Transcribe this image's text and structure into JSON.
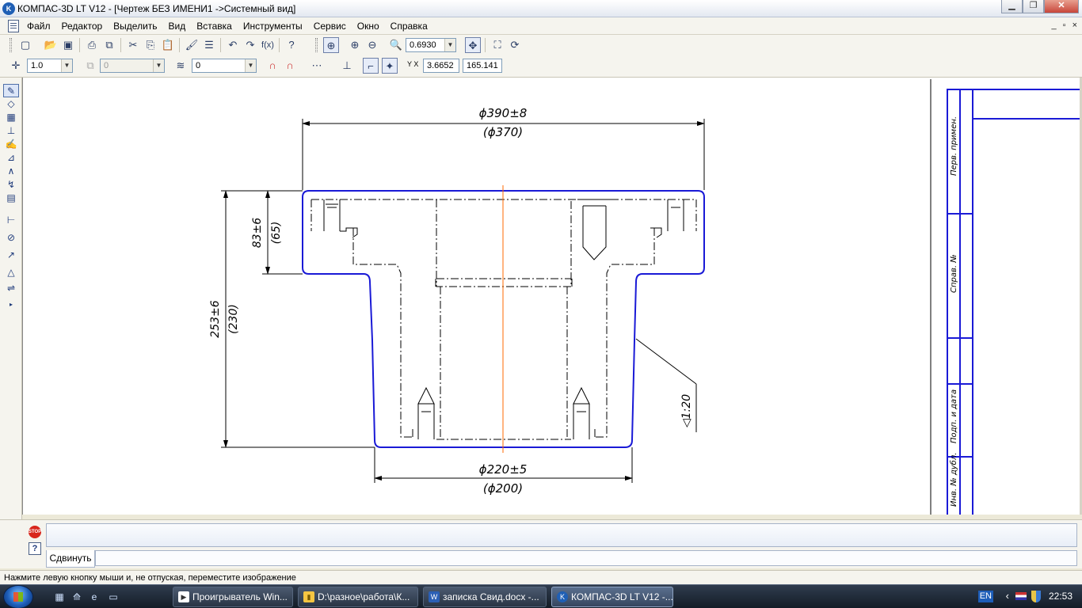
{
  "window": {
    "title": "КОМПАС-3D LT V12 - [Чертеж БЕЗ ИМЕНИ1 ->Системный вид]",
    "app_icon_text": "K",
    "minimize_glyph": "▁",
    "restore_glyph": "❐",
    "close_glyph": "✕"
  },
  "menu": {
    "items": [
      "Файл",
      "Редактор",
      "Выделить",
      "Вид",
      "Вставка",
      "Инструменты",
      "Сервис",
      "Окно",
      "Справка"
    ],
    "mdi": [
      "_",
      "▫",
      "×"
    ]
  },
  "toolbar1": {
    "zoom_value": "0.6930",
    "function_label": "f(x)"
  },
  "toolbar2": {
    "line_scale": "1.0",
    "layer_disabled": "0",
    "style_value": "0",
    "coord_x": "3.6652",
    "coord_y": "165.141",
    "coord_label": "Y X"
  },
  "left_tools": [
    "✎",
    "◇",
    "▦",
    "⊥",
    "✍",
    "⊿",
    "∧",
    "↯",
    "▤",
    "⊢",
    "⊘",
    "↗",
    "△",
    "⇌",
    "▸"
  ],
  "drawing": {
    "dim_top_outer": "ϕ390±8",
    "dim_top_inner": "(ϕ370)",
    "dim_flange_h": "83±6",
    "dim_flange_h_ref": "(65)",
    "dim_total_h": "253±6",
    "dim_total_h_ref": "(230)",
    "dim_bottom_outer": "ϕ220±5",
    "dim_bottom_inner": "(ϕ200)",
    "taper": "◁1:20",
    "frame_labels": [
      "Перв. примен.",
      "Справ. №",
      "Подп. и дата",
      "Инв. № дубл."
    ],
    "colors": {
      "outline": "#1a1ad6",
      "axis": "#ff6a00",
      "line": "#000000"
    }
  },
  "command": {
    "stop_label": "STOP",
    "help_label": "?",
    "tab_label": "Сдвинуть"
  },
  "status": {
    "text": "Нажмите левую кнопку мыши и, не отпуская, переместите изображение"
  },
  "taskbar": {
    "tasks": [
      {
        "label": "Проигрыватель Win...",
        "icon": "▶",
        "color": "#ffffff"
      },
      {
        "label": "D:\\разное\\работа\\К...",
        "icon": "▮",
        "color": "#f5c542"
      },
      {
        "label": "записка Свид.docx -...",
        "icon": "W",
        "color": "#2b5fb5"
      },
      {
        "label": "КОМПАС-3D LT V12 -...",
        "icon": "K",
        "color": "#1f5fb5"
      }
    ],
    "lang": "EN",
    "clock": "22:53"
  }
}
